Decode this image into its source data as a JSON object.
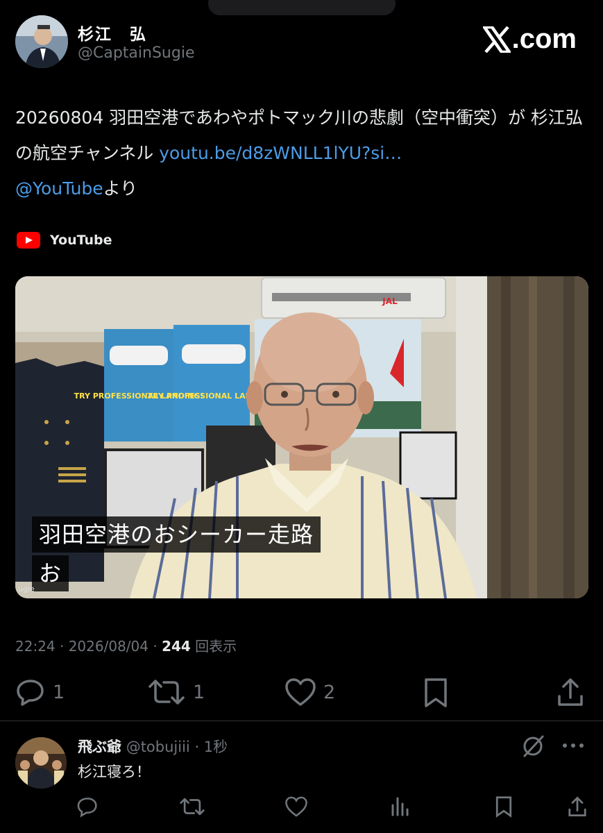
{
  "author": {
    "name": "杉江　弘",
    "handle": "@CaptainSugie"
  },
  "brand": {
    "site": ".com"
  },
  "tweet": {
    "text_prefix": "20260804 羽田空港であわやポトマック川の悲劇（空中衝突）が 杉江弘の航空チャンネル ",
    "link": "youtu.be/d8zWNLL1lYU?si…",
    "mention": "@YouTube",
    "suffix": "より"
  },
  "card": {
    "source": "YouTube",
    "caption_line1": "羽田空港のおシーカー走路",
    "caption_line2": "お",
    "corner_text": "ugie",
    "poster_text_1": "TRY PROFESSIONAL LANDING!",
    "poster_text_2": "TRY PROFESSIONAL LANDING!",
    "jal_text": "JAL"
  },
  "meta": {
    "time_date": "22:24 · 2026/08/04 · ",
    "views": "244",
    "views_label": " 回表示"
  },
  "actions": {
    "replies": "1",
    "reposts": "1",
    "likes": "2"
  },
  "reply": {
    "name": "飛ぶ爺",
    "handle": "@tobujiii",
    "time": "· 1秒",
    "text": "杉江寝ろ！"
  },
  "icons": [
    "reply-icon",
    "repost-icon",
    "like-icon",
    "bookmark-icon",
    "share-icon",
    "grok-icon",
    "more-icon",
    "views-icon"
  ],
  "colors": {
    "link": "#4c9ce8",
    "muted": "#71767b",
    "youtube_red": "#ff0000"
  }
}
